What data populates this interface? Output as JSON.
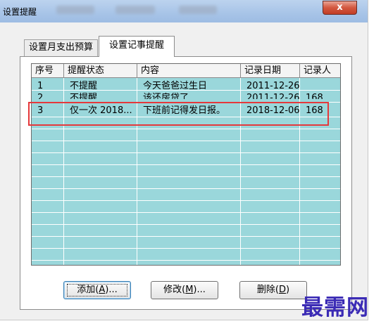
{
  "window": {
    "title": "设置提醒",
    "close_glyph": "x"
  },
  "tabs": [
    {
      "label": "设置月支出预算",
      "active": false
    },
    {
      "label": "设置记事提醒",
      "active": true
    }
  ],
  "list": {
    "columns": [
      "序号",
      "提醒状态",
      "内容",
      "记录日期",
      "记录人"
    ],
    "rows": [
      [
        "1",
        "不提醒",
        "今天爸爸过生日",
        "2011-12-26",
        ""
      ],
      [
        "2",
        "不提醒",
        "该还房贷了",
        "2011-12-26",
        "168"
      ],
      [
        "3",
        "仅一次 2018...",
        "下班前记得发日报。",
        "2018-12-06",
        "168"
      ]
    ]
  },
  "buttons": {
    "add": {
      "text": "添加(",
      "mnemonic": "A",
      "suffix": ")..."
    },
    "edit": {
      "text": "修改(",
      "mnemonic": "M",
      "suffix": ")..."
    },
    "delete": {
      "text": "删除(",
      "mnemonic": "D",
      "suffix": ")"
    }
  },
  "watermark": "最需网",
  "colors": {
    "list_background": "#9ad7db",
    "highlight_box": "#e5383b",
    "watermark": "#3b2bb5"
  }
}
